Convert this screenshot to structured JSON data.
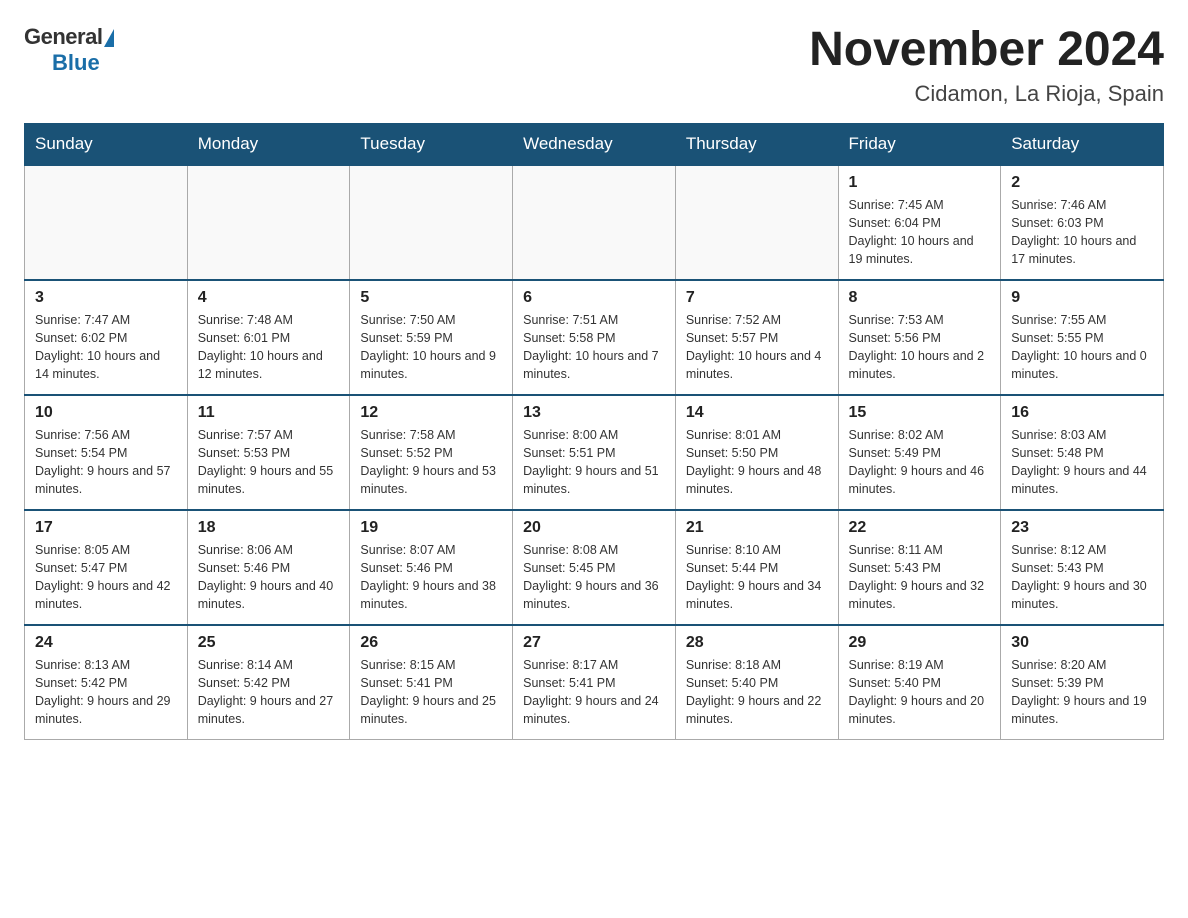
{
  "logo": {
    "text_general": "General",
    "text_blue": "Blue"
  },
  "title": "November 2024",
  "subtitle": "Cidamon, La Rioja, Spain",
  "days_of_week": [
    "Sunday",
    "Monday",
    "Tuesday",
    "Wednesday",
    "Thursday",
    "Friday",
    "Saturday"
  ],
  "weeks": [
    [
      {
        "day": "",
        "sunrise": "",
        "sunset": "",
        "daylight": ""
      },
      {
        "day": "",
        "sunrise": "",
        "sunset": "",
        "daylight": ""
      },
      {
        "day": "",
        "sunrise": "",
        "sunset": "",
        "daylight": ""
      },
      {
        "day": "",
        "sunrise": "",
        "sunset": "",
        "daylight": ""
      },
      {
        "day": "",
        "sunrise": "",
        "sunset": "",
        "daylight": ""
      },
      {
        "day": "1",
        "sunrise": "Sunrise: 7:45 AM",
        "sunset": "Sunset: 6:04 PM",
        "daylight": "Daylight: 10 hours and 19 minutes."
      },
      {
        "day": "2",
        "sunrise": "Sunrise: 7:46 AM",
        "sunset": "Sunset: 6:03 PM",
        "daylight": "Daylight: 10 hours and 17 minutes."
      }
    ],
    [
      {
        "day": "3",
        "sunrise": "Sunrise: 7:47 AM",
        "sunset": "Sunset: 6:02 PM",
        "daylight": "Daylight: 10 hours and 14 minutes."
      },
      {
        "day": "4",
        "sunrise": "Sunrise: 7:48 AM",
        "sunset": "Sunset: 6:01 PM",
        "daylight": "Daylight: 10 hours and 12 minutes."
      },
      {
        "day": "5",
        "sunrise": "Sunrise: 7:50 AM",
        "sunset": "Sunset: 5:59 PM",
        "daylight": "Daylight: 10 hours and 9 minutes."
      },
      {
        "day": "6",
        "sunrise": "Sunrise: 7:51 AM",
        "sunset": "Sunset: 5:58 PM",
        "daylight": "Daylight: 10 hours and 7 minutes."
      },
      {
        "day": "7",
        "sunrise": "Sunrise: 7:52 AM",
        "sunset": "Sunset: 5:57 PM",
        "daylight": "Daylight: 10 hours and 4 minutes."
      },
      {
        "day": "8",
        "sunrise": "Sunrise: 7:53 AM",
        "sunset": "Sunset: 5:56 PM",
        "daylight": "Daylight: 10 hours and 2 minutes."
      },
      {
        "day": "9",
        "sunrise": "Sunrise: 7:55 AM",
        "sunset": "Sunset: 5:55 PM",
        "daylight": "Daylight: 10 hours and 0 minutes."
      }
    ],
    [
      {
        "day": "10",
        "sunrise": "Sunrise: 7:56 AM",
        "sunset": "Sunset: 5:54 PM",
        "daylight": "Daylight: 9 hours and 57 minutes."
      },
      {
        "day": "11",
        "sunrise": "Sunrise: 7:57 AM",
        "sunset": "Sunset: 5:53 PM",
        "daylight": "Daylight: 9 hours and 55 minutes."
      },
      {
        "day": "12",
        "sunrise": "Sunrise: 7:58 AM",
        "sunset": "Sunset: 5:52 PM",
        "daylight": "Daylight: 9 hours and 53 minutes."
      },
      {
        "day": "13",
        "sunrise": "Sunrise: 8:00 AM",
        "sunset": "Sunset: 5:51 PM",
        "daylight": "Daylight: 9 hours and 51 minutes."
      },
      {
        "day": "14",
        "sunrise": "Sunrise: 8:01 AM",
        "sunset": "Sunset: 5:50 PM",
        "daylight": "Daylight: 9 hours and 48 minutes."
      },
      {
        "day": "15",
        "sunrise": "Sunrise: 8:02 AM",
        "sunset": "Sunset: 5:49 PM",
        "daylight": "Daylight: 9 hours and 46 minutes."
      },
      {
        "day": "16",
        "sunrise": "Sunrise: 8:03 AM",
        "sunset": "Sunset: 5:48 PM",
        "daylight": "Daylight: 9 hours and 44 minutes."
      }
    ],
    [
      {
        "day": "17",
        "sunrise": "Sunrise: 8:05 AM",
        "sunset": "Sunset: 5:47 PM",
        "daylight": "Daylight: 9 hours and 42 minutes."
      },
      {
        "day": "18",
        "sunrise": "Sunrise: 8:06 AM",
        "sunset": "Sunset: 5:46 PM",
        "daylight": "Daylight: 9 hours and 40 minutes."
      },
      {
        "day": "19",
        "sunrise": "Sunrise: 8:07 AM",
        "sunset": "Sunset: 5:46 PM",
        "daylight": "Daylight: 9 hours and 38 minutes."
      },
      {
        "day": "20",
        "sunrise": "Sunrise: 8:08 AM",
        "sunset": "Sunset: 5:45 PM",
        "daylight": "Daylight: 9 hours and 36 minutes."
      },
      {
        "day": "21",
        "sunrise": "Sunrise: 8:10 AM",
        "sunset": "Sunset: 5:44 PM",
        "daylight": "Daylight: 9 hours and 34 minutes."
      },
      {
        "day": "22",
        "sunrise": "Sunrise: 8:11 AM",
        "sunset": "Sunset: 5:43 PM",
        "daylight": "Daylight: 9 hours and 32 minutes."
      },
      {
        "day": "23",
        "sunrise": "Sunrise: 8:12 AM",
        "sunset": "Sunset: 5:43 PM",
        "daylight": "Daylight: 9 hours and 30 minutes."
      }
    ],
    [
      {
        "day": "24",
        "sunrise": "Sunrise: 8:13 AM",
        "sunset": "Sunset: 5:42 PM",
        "daylight": "Daylight: 9 hours and 29 minutes."
      },
      {
        "day": "25",
        "sunrise": "Sunrise: 8:14 AM",
        "sunset": "Sunset: 5:42 PM",
        "daylight": "Daylight: 9 hours and 27 minutes."
      },
      {
        "day": "26",
        "sunrise": "Sunrise: 8:15 AM",
        "sunset": "Sunset: 5:41 PM",
        "daylight": "Daylight: 9 hours and 25 minutes."
      },
      {
        "day": "27",
        "sunrise": "Sunrise: 8:17 AM",
        "sunset": "Sunset: 5:41 PM",
        "daylight": "Daylight: 9 hours and 24 minutes."
      },
      {
        "day": "28",
        "sunrise": "Sunrise: 8:18 AM",
        "sunset": "Sunset: 5:40 PM",
        "daylight": "Daylight: 9 hours and 22 minutes."
      },
      {
        "day": "29",
        "sunrise": "Sunrise: 8:19 AM",
        "sunset": "Sunset: 5:40 PM",
        "daylight": "Daylight: 9 hours and 20 minutes."
      },
      {
        "day": "30",
        "sunrise": "Sunrise: 8:20 AM",
        "sunset": "Sunset: 5:39 PM",
        "daylight": "Daylight: 9 hours and 19 minutes."
      }
    ]
  ]
}
